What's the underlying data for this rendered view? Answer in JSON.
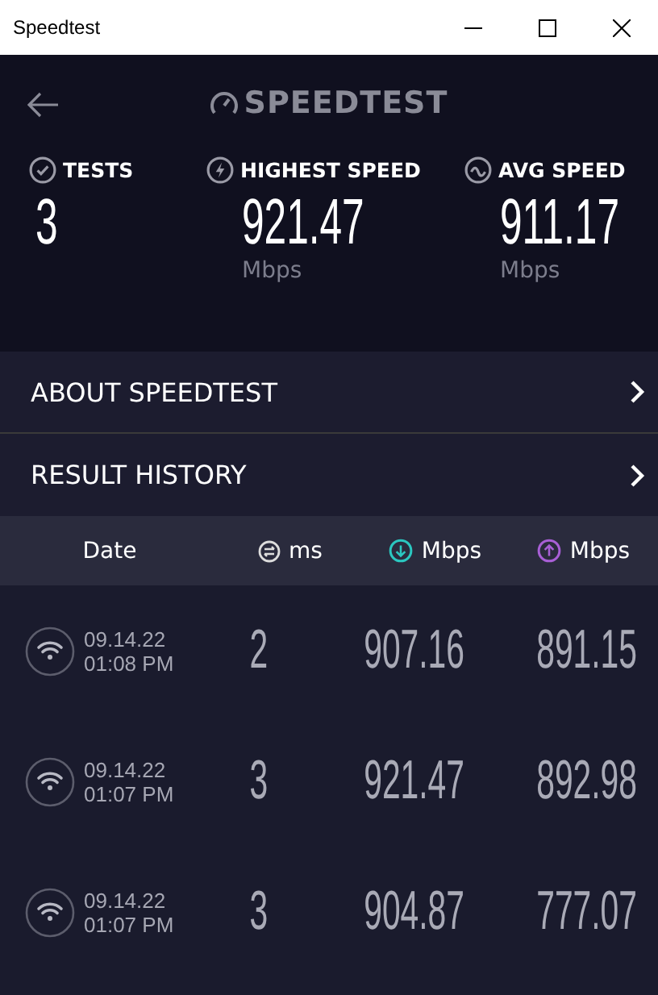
{
  "window": {
    "title": "Speedtest"
  },
  "header": {
    "logo": "SPEEDTEST"
  },
  "stats": [
    {
      "kind": "tests",
      "label": "TESTS",
      "value": "3"
    },
    {
      "kind": "highest",
      "label": "HIGHEST SPEED",
      "value": "921.47",
      "unit": "Mbps"
    },
    {
      "kind": "average",
      "label": "AVG SPEED",
      "value": "911.17",
      "unit": "Mbps"
    }
  ],
  "menu": [
    {
      "label": "ABOUT SPEEDTEST"
    },
    {
      "label": "RESULT HISTORY"
    }
  ],
  "table": {
    "columns": [
      {
        "kind": "date",
        "label": "Date"
      },
      {
        "kind": "ping",
        "label": "ms"
      },
      {
        "kind": "download",
        "label": "Mbps"
      },
      {
        "kind": "upload",
        "label": "Mbps"
      }
    ],
    "rows": [
      {
        "date": "09.14.22",
        "time": "01:08 PM",
        "ping": "2",
        "download": "907.16",
        "upload": "891.15"
      },
      {
        "date": "09.14.22",
        "time": "01:07 PM",
        "ping": "3",
        "download": "921.47",
        "upload": "892.98"
      },
      {
        "date": "09.14.22",
        "time": "01:07 PM",
        "ping": "3",
        "download": "904.87",
        "upload": "777.07"
      }
    ]
  }
}
